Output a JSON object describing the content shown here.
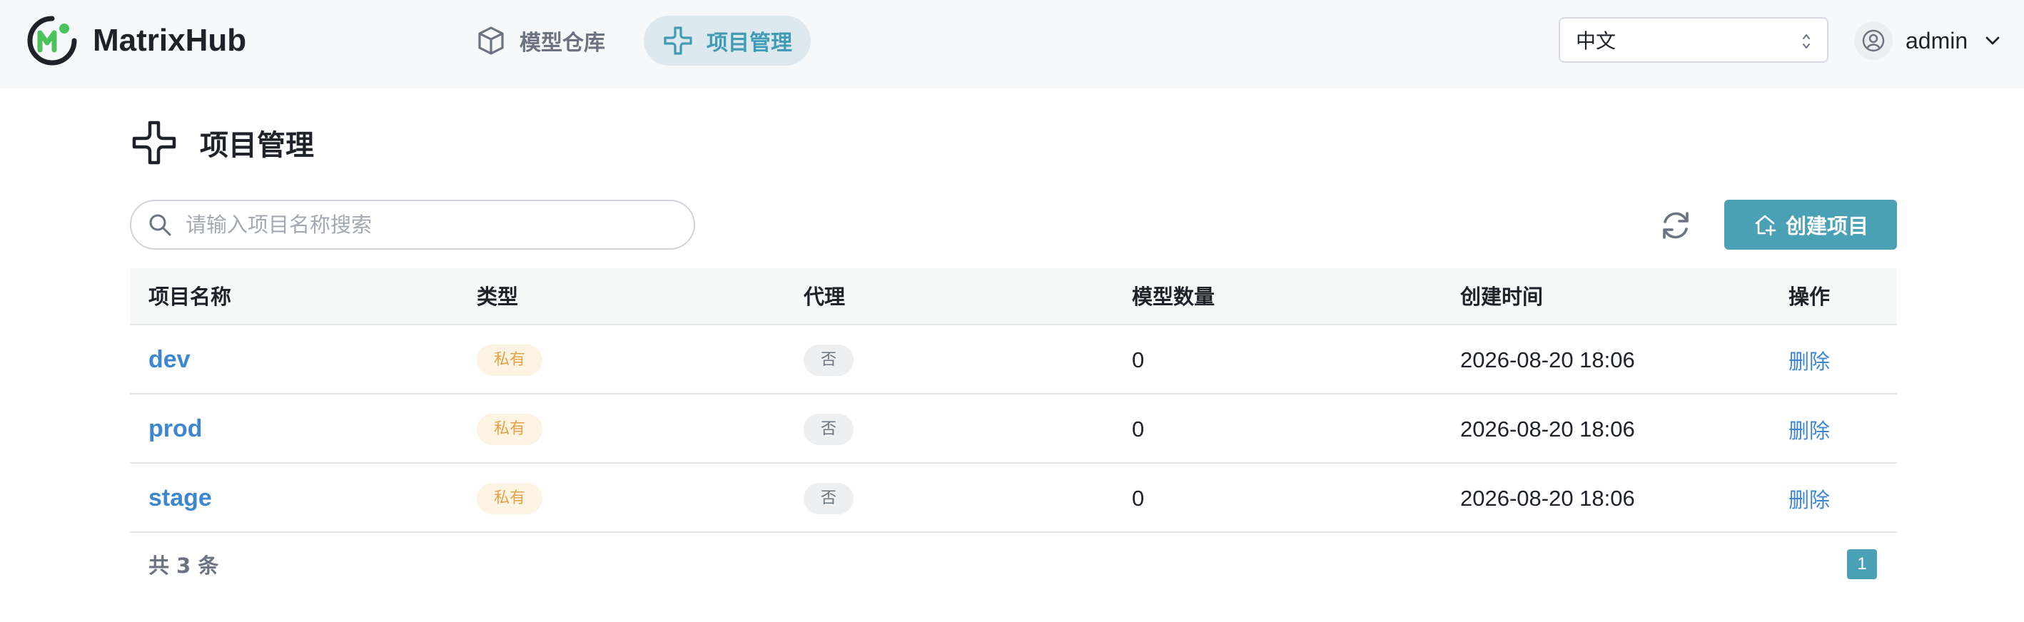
{
  "app": {
    "name": "MatrixHub"
  },
  "nav": {
    "tabs": [
      {
        "label": "模型仓库",
        "icon": "cube-icon",
        "active": false
      },
      {
        "label": "项目管理",
        "icon": "project-icon",
        "active": true
      }
    ]
  },
  "language": {
    "selected": "中文"
  },
  "user": {
    "name": "admin"
  },
  "page": {
    "title": "项目管理"
  },
  "search": {
    "placeholder": "请输入项目名称搜索",
    "value": ""
  },
  "toolbar": {
    "create_label": "创建项目"
  },
  "table": {
    "columns": [
      "项目名称",
      "类型",
      "代理",
      "模型数量",
      "创建时间",
      "操作"
    ],
    "rows": [
      {
        "name": "dev",
        "type": "私有",
        "proxy": "否",
        "model_count": "0",
        "created": "2026-08-20 18:06",
        "action": "删除"
      },
      {
        "name": "prod",
        "type": "私有",
        "proxy": "否",
        "model_count": "0",
        "created": "2026-08-20 18:06",
        "action": "删除"
      },
      {
        "name": "stage",
        "type": "私有",
        "proxy": "否",
        "model_count": "0",
        "created": "2026-08-20 18:06",
        "action": "删除"
      }
    ]
  },
  "pagination": {
    "total_text": "共 3 条",
    "current_page": "1"
  },
  "colors": {
    "accent": "#4aa0b5",
    "link": "#3e86d0",
    "tag_private_bg": "#fdf3e3",
    "tag_private_text": "#e3a247",
    "logo_green": "#4cc25c"
  }
}
